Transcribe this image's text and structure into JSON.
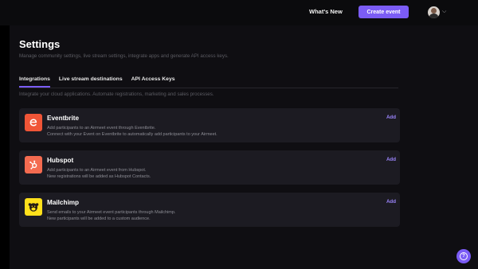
{
  "header": {
    "whats_new": "What's New",
    "create_event": "Create event"
  },
  "page": {
    "title": "Settings",
    "subtitle": "Manage community settings, live stream settings, integrate apps and generate API access keys."
  },
  "tabs": [
    {
      "label": "Integrations",
      "active": true
    },
    {
      "label": "Live stream destinations",
      "active": false
    },
    {
      "label": "API Access Keys",
      "active": false
    }
  ],
  "integrations_description": "Integrate your cloud applications. Automate registrations, marketing and sales processes.",
  "integrations": [
    {
      "name": "Eventbrite",
      "line1": "Add participants to an Airmeet event through Eventbrite.",
      "line2": "Connect with your Event on Eventbrite to automatically add participants to your Airmeet.",
      "action": "Add",
      "icon": "eventbrite-logo",
      "color": "#f05537"
    },
    {
      "name": "Hubspot",
      "line1": "Add participants to an Airmeet event from Hubspot.",
      "line2": "New registrations will be added as Hubspot Contacts.",
      "action": "Add",
      "icon": "hubspot-logo",
      "color": "#f46b50"
    },
    {
      "name": "Mailchimp",
      "line1": "Send emails to your Airmeet event participants through Mailchimp.",
      "line2": "New participants will be added to a custom audience.",
      "action": "Add",
      "icon": "mailchimp-logo",
      "color": "#ffe01b"
    }
  ],
  "help": {
    "icon": "help-icon",
    "glyph": "?"
  },
  "colors": {
    "accent": "#7b5cf5",
    "link": "#9d86ff",
    "card": "#1c1b22",
    "panel": "#0f0e12"
  }
}
